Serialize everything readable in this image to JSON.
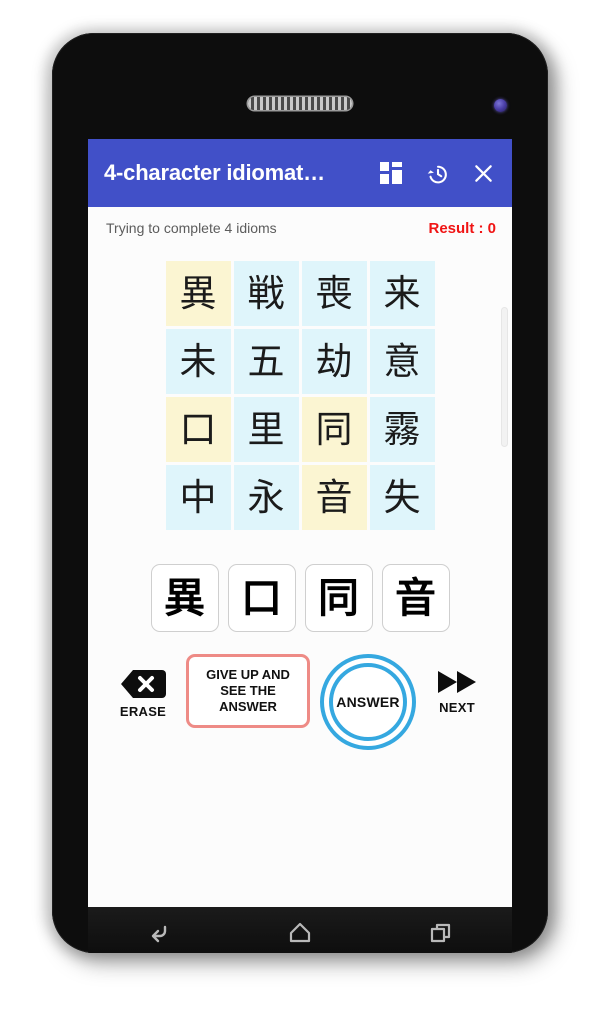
{
  "app": {
    "title": "4-character idiomat…",
    "status_text": "Trying to complete 4 idioms",
    "result_text": "Result : 0"
  },
  "appbar_icons": {
    "dashboard": "dashboard-icon",
    "history": "history-icon",
    "close": "close-icon"
  },
  "grid": {
    "rows": [
      [
        {
          "char": "異",
          "color": "yellow"
        },
        {
          "char": "戦",
          "color": "blue"
        },
        {
          "char": "喪",
          "color": "blue"
        },
        {
          "char": "来",
          "color": "blue"
        }
      ],
      [
        {
          "char": "未",
          "color": "blue"
        },
        {
          "char": "五",
          "color": "blue"
        },
        {
          "char": "劫",
          "color": "blue"
        },
        {
          "char": "意",
          "color": "blue"
        }
      ],
      [
        {
          "char": "口",
          "color": "yellow"
        },
        {
          "char": "里",
          "color": "blue"
        },
        {
          "char": "同",
          "color": "yellow"
        },
        {
          "char": "霧",
          "color": "blue"
        }
      ],
      [
        {
          "char": "中",
          "color": "blue"
        },
        {
          "char": "永",
          "color": "blue"
        },
        {
          "char": "音",
          "color": "yellow"
        },
        {
          "char": "失",
          "color": "blue"
        }
      ]
    ],
    "tile_color_blue": "#dff5fb",
    "tile_color_yellow": "#fbf5d2"
  },
  "answer_slots": [
    "異",
    "口",
    "同",
    "音"
  ],
  "controls": {
    "erase_label": "ERASE",
    "giveup_label": "GIVE UP AND SEE THE ANSWER",
    "answer_label": "ANSWER",
    "next_label": "NEXT",
    "giveup_border_color": "#ee8b86",
    "answer_circle_color": "#35a8e0"
  },
  "navbar": {
    "back": "back-icon",
    "home": "home-icon",
    "recents": "recents-icon"
  },
  "theme": {
    "appbar_color": "#4150c8",
    "result_color": "#f01414",
    "screen_bg": "#fcfcfc"
  }
}
